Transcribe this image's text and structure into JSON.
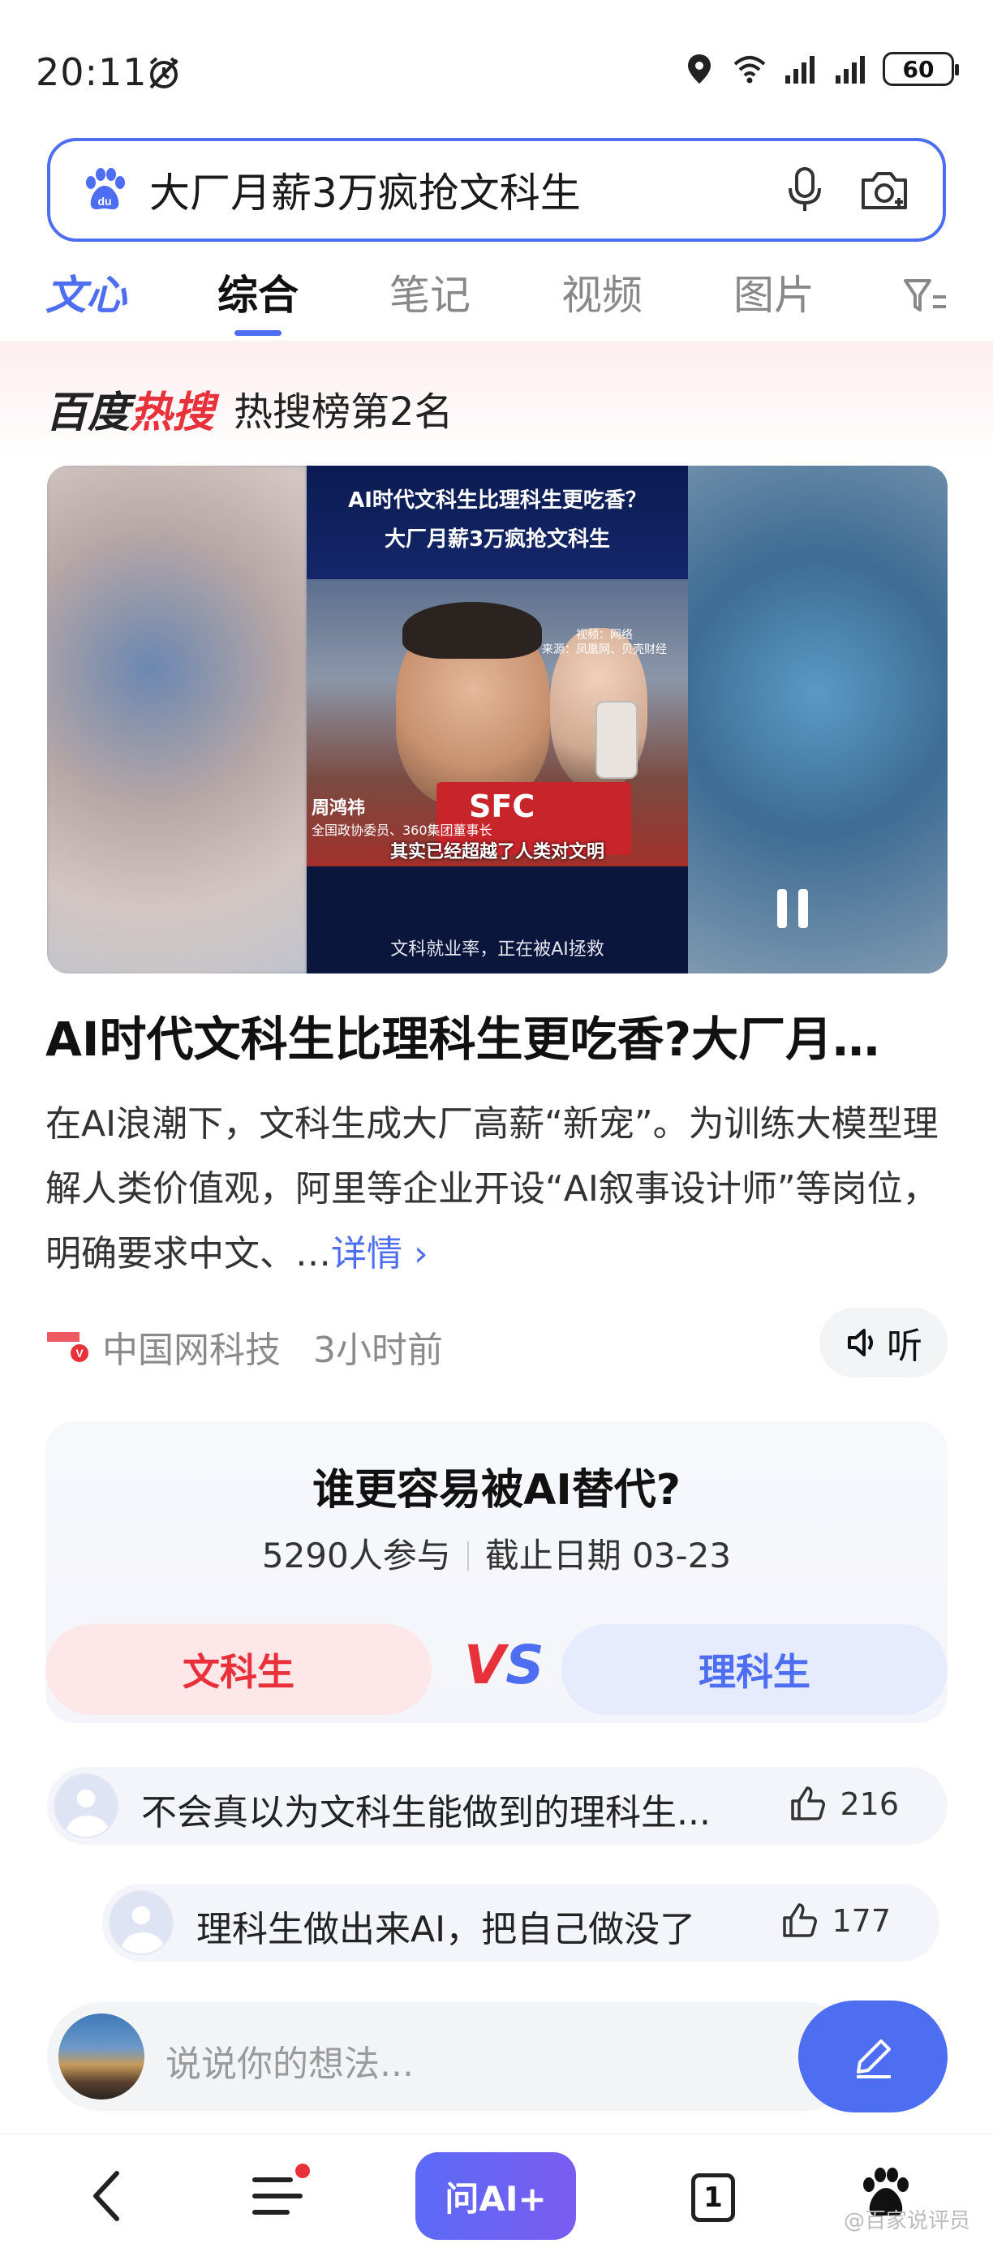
{
  "status_bar": {
    "time": "20:11",
    "battery": "60"
  },
  "search": {
    "query": "大厂月薪3万疯抢文科生"
  },
  "tabs": [
    {
      "label": "文心"
    },
    {
      "label": "综合"
    },
    {
      "label": "笔记"
    },
    {
      "label": "视频"
    },
    {
      "label": "图片"
    }
  ],
  "hot": {
    "logo_part1": "百度",
    "logo_part2": "热搜",
    "rank_text": "热搜榜第2名"
  },
  "video": {
    "title_line1": "AI时代文科生比理科生更吃香？",
    "title_line2": "大厂月薪3万疯抢文科生",
    "source_line1": "视频：网络",
    "source_line2": "来源：凤凰网、贝壳财经",
    "banner_text": "SFC",
    "person_name": "周鸿祎",
    "person_role": "全国政协委员、360集团董事长",
    "subtitle": "其实已经超越了人类对文明",
    "bottom_caption": "文科就业率，正在被AI拯救"
  },
  "article": {
    "title": "AI时代文科生比理科生更吃香?大厂月…",
    "summary": "在AI浪潮下，文科生成大厂高薪“新宠”。为训练大模型理解人类价值观，阿里等企业开设“AI叙事设计师”等岗位，明确要求中文、…",
    "more_label": "详情",
    "source_name": "中国网科技",
    "time": "3小时前",
    "listen_label": "听"
  },
  "poll": {
    "question": "谁更容易被AI替代?",
    "participants": "5290人参与",
    "deadline": "截止日期 03-23",
    "option_a": "文科生",
    "option_b": "理科生",
    "vs_v": "V",
    "vs_s": "S"
  },
  "comments": [
    {
      "text": "不会真以为文科生能做到的理科生...",
      "likes": "216"
    },
    {
      "text": "理科生做出来AI，把自己做没了",
      "likes": "177"
    }
  ],
  "input": {
    "placeholder": "说说你的想法..."
  },
  "bottom_nav": {
    "ask_ai_label": "问AI+",
    "tab_count": "1",
    "watermark": "@百家说评员"
  },
  "colors": {
    "accent": "#4e6ef2",
    "hot_red": "#e8313a"
  }
}
